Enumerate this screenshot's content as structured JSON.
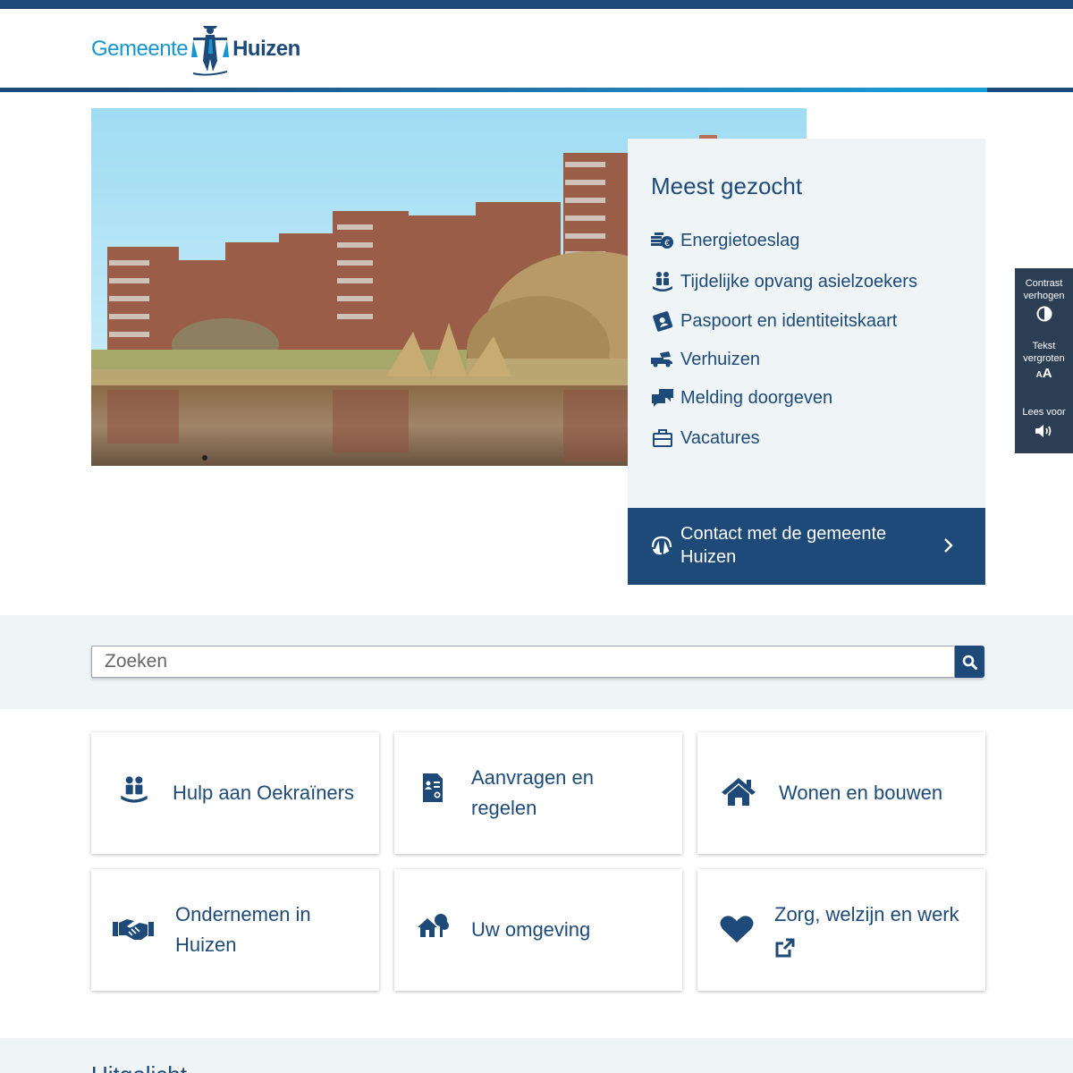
{
  "header": {
    "logo_word1": "Gemeente",
    "logo_word2": "Huizen"
  },
  "hero": {
    "image_alt": "Flatgebouwen aan het water"
  },
  "popular": {
    "title": "Meest gezocht",
    "items": [
      {
        "label": "Energietoeslag",
        "icon": "coins-euro-icon"
      },
      {
        "label": "Tijdelijke opvang asielzoekers",
        "icon": "people-care-icon"
      },
      {
        "label": "Paspoort en identiteitskaart",
        "icon": "id-card-icon"
      },
      {
        "label": "Verhuizen",
        "icon": "moving-truck-icon"
      },
      {
        "label": "Melding doorgeven",
        "icon": "chat-bubbles-icon"
      },
      {
        "label": "Vacatures",
        "icon": "briefcase-icon"
      }
    ]
  },
  "contact": {
    "label": "Contact met de gemeente Huizen"
  },
  "accessibility": {
    "contrast": "Contrast verhogen",
    "text_size": "Tekst vergroten",
    "read_aloud": "Lees voor"
  },
  "search": {
    "placeholder": "Zoeken"
  },
  "tiles": [
    {
      "label": "Hulp aan Oekraïners",
      "icon": "people-care-icon"
    },
    {
      "label": "Aanvragen en regelen",
      "icon": "document-certificate-icon"
    },
    {
      "label": "Wonen en bouwen",
      "icon": "house-icon"
    },
    {
      "label": "Ondernemen in Huizen",
      "icon": "handshake-icon"
    },
    {
      "label": "Uw omgeving",
      "icon": "house-tree-icon"
    },
    {
      "label": "Zorg, welzijn en werk",
      "icon": "heart-icon",
      "external": true
    }
  ],
  "featured": {
    "title": "Uitgelicht"
  },
  "colors": {
    "primary": "#1d4a78",
    "accent": "#1596d1",
    "band": "#eff4f7"
  }
}
